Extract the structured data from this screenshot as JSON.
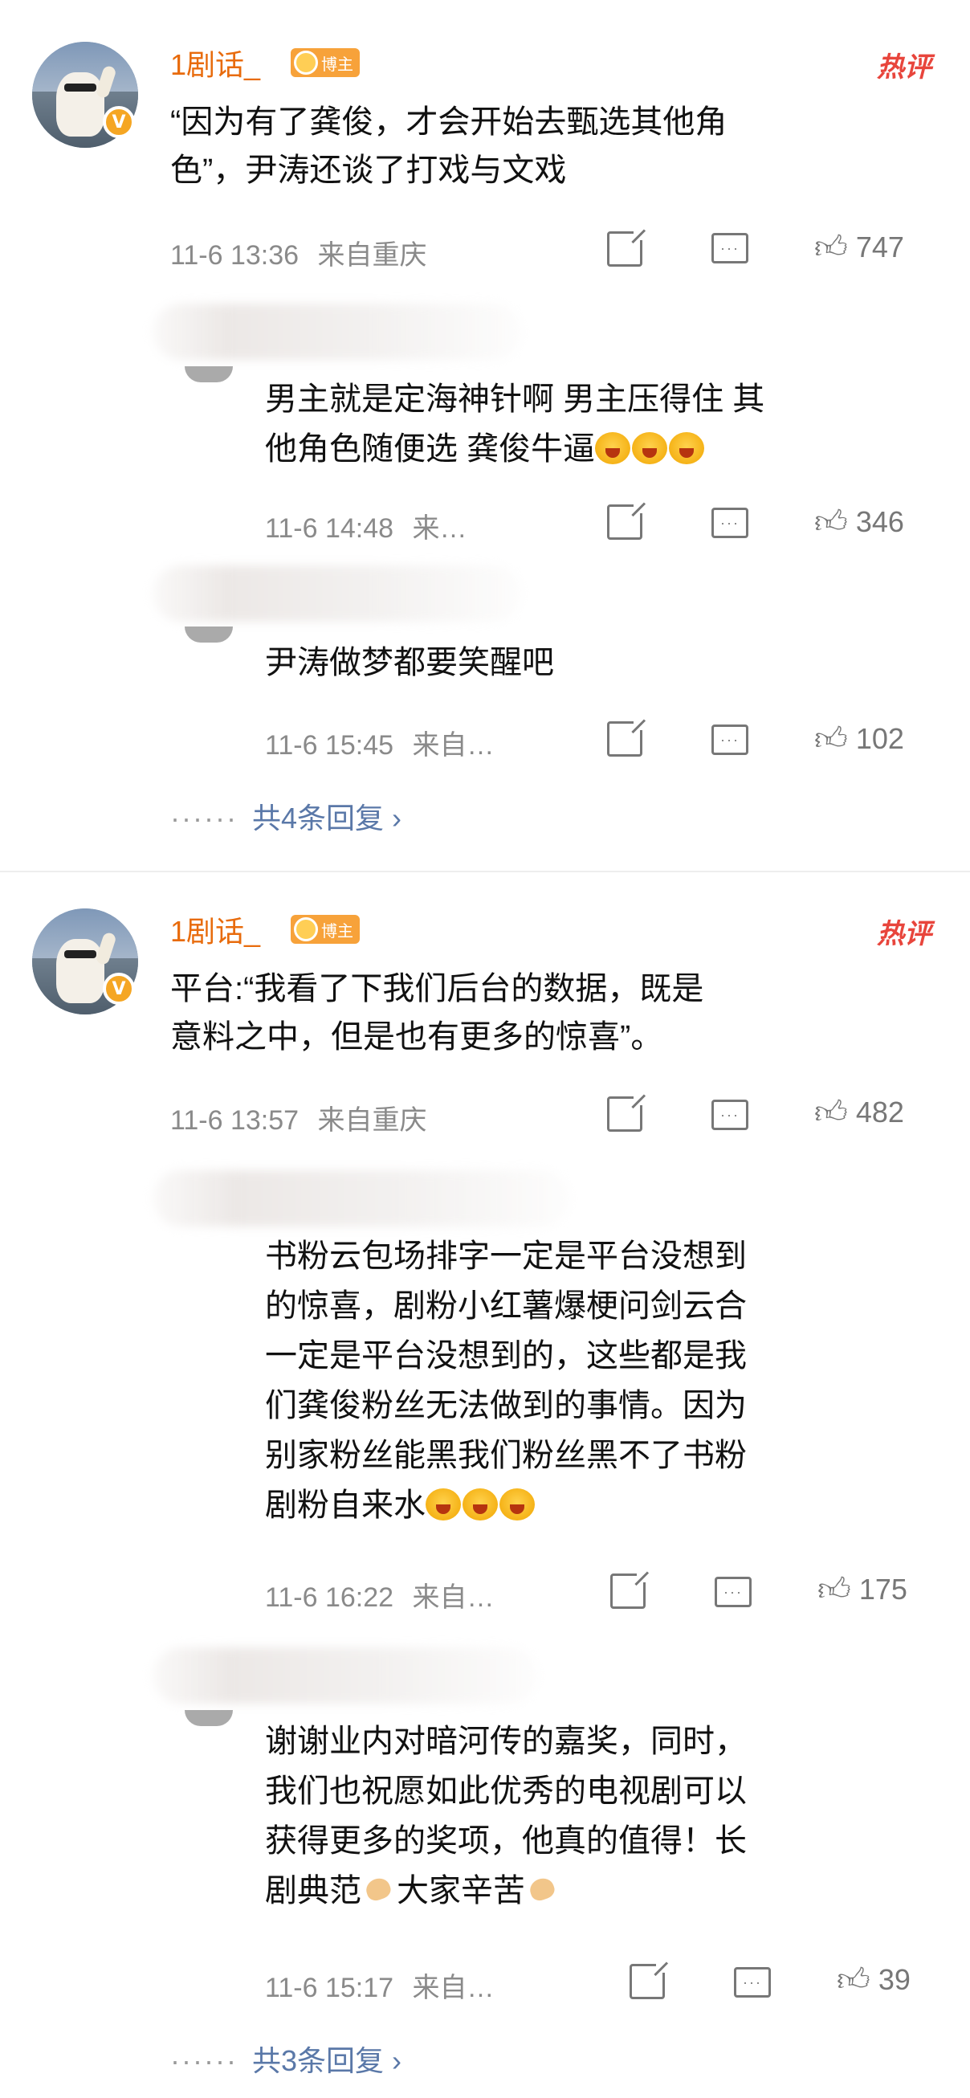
{
  "comments": [
    {
      "username": "1剧话_",
      "badge": "博主",
      "hot_tag": "热评",
      "text_lines": [
        "“因为有了龚俊，才会开始去甄选其他角",
        "色”，尹涛还谈了打戏与文戏"
      ],
      "time": "11-6 13:36",
      "location": "来自重庆",
      "likes": "747",
      "replies": [
        {
          "text_lines": [
            "男主就是定海神针啊 男主压得住 其",
            "他角色随便选 龚俊牛逼"
          ],
          "emoji_count": 3,
          "time": "11-6 14:48",
          "location": "来…",
          "likes": "346"
        },
        {
          "text_lines": [
            "尹涛做梦都要笑醒吧"
          ],
          "emoji_count": 0,
          "time": "11-6 15:45",
          "location": "来自…",
          "likes": "102"
        }
      ],
      "more_dots": "······",
      "more_replies": "共4条回复 ›"
    },
    {
      "username": "1剧话_",
      "badge": "博主",
      "hot_tag": "热评",
      "text_lines": [
        "平台:“我看了下我们后台的数据，既是",
        "意料之中，但是也有更多的惊喜”。"
      ],
      "time": "11-6 13:57",
      "location": "来自重庆",
      "likes": "482",
      "replies": [
        {
          "text_lines": [
            "书粉云包场排字一定是平台没想到",
            "的惊喜，剧粉小红薯爆梗问剑云合",
            "一定是平台没想到的，这些都是我",
            "们龚俊粉丝无法做到的事情。因为",
            "别家粉丝能黑我们粉丝黑不了书粉",
            "剧粉自来水"
          ],
          "emoji_count": 3,
          "time": "11-6 16:22",
          "location": "来自…",
          "likes": "175"
        },
        {
          "text_lines": [
            "谢谢业内对暗河传的嘉奖，同时，",
            "我们也祝愿如此优秀的电视剧可以",
            "获得更多的奖项，他真的值得！长",
            "剧典范",
            "大家辛苦"
          ],
          "emoji_count": 0,
          "time": "11-6 15:17",
          "location": "来自…",
          "likes": "39"
        }
      ],
      "more_dots": "······",
      "more_replies": "共3条回复 ›"
    }
  ],
  "icons": {
    "share": "share-icon",
    "comment": "comment-icon",
    "like": "thumb-up-icon",
    "verified": "verified-v-icon"
  },
  "colors": {
    "username": "#e86b0c",
    "hot": "#e8453c",
    "link": "#5a78a8",
    "meta": "#8a8a8a"
  }
}
